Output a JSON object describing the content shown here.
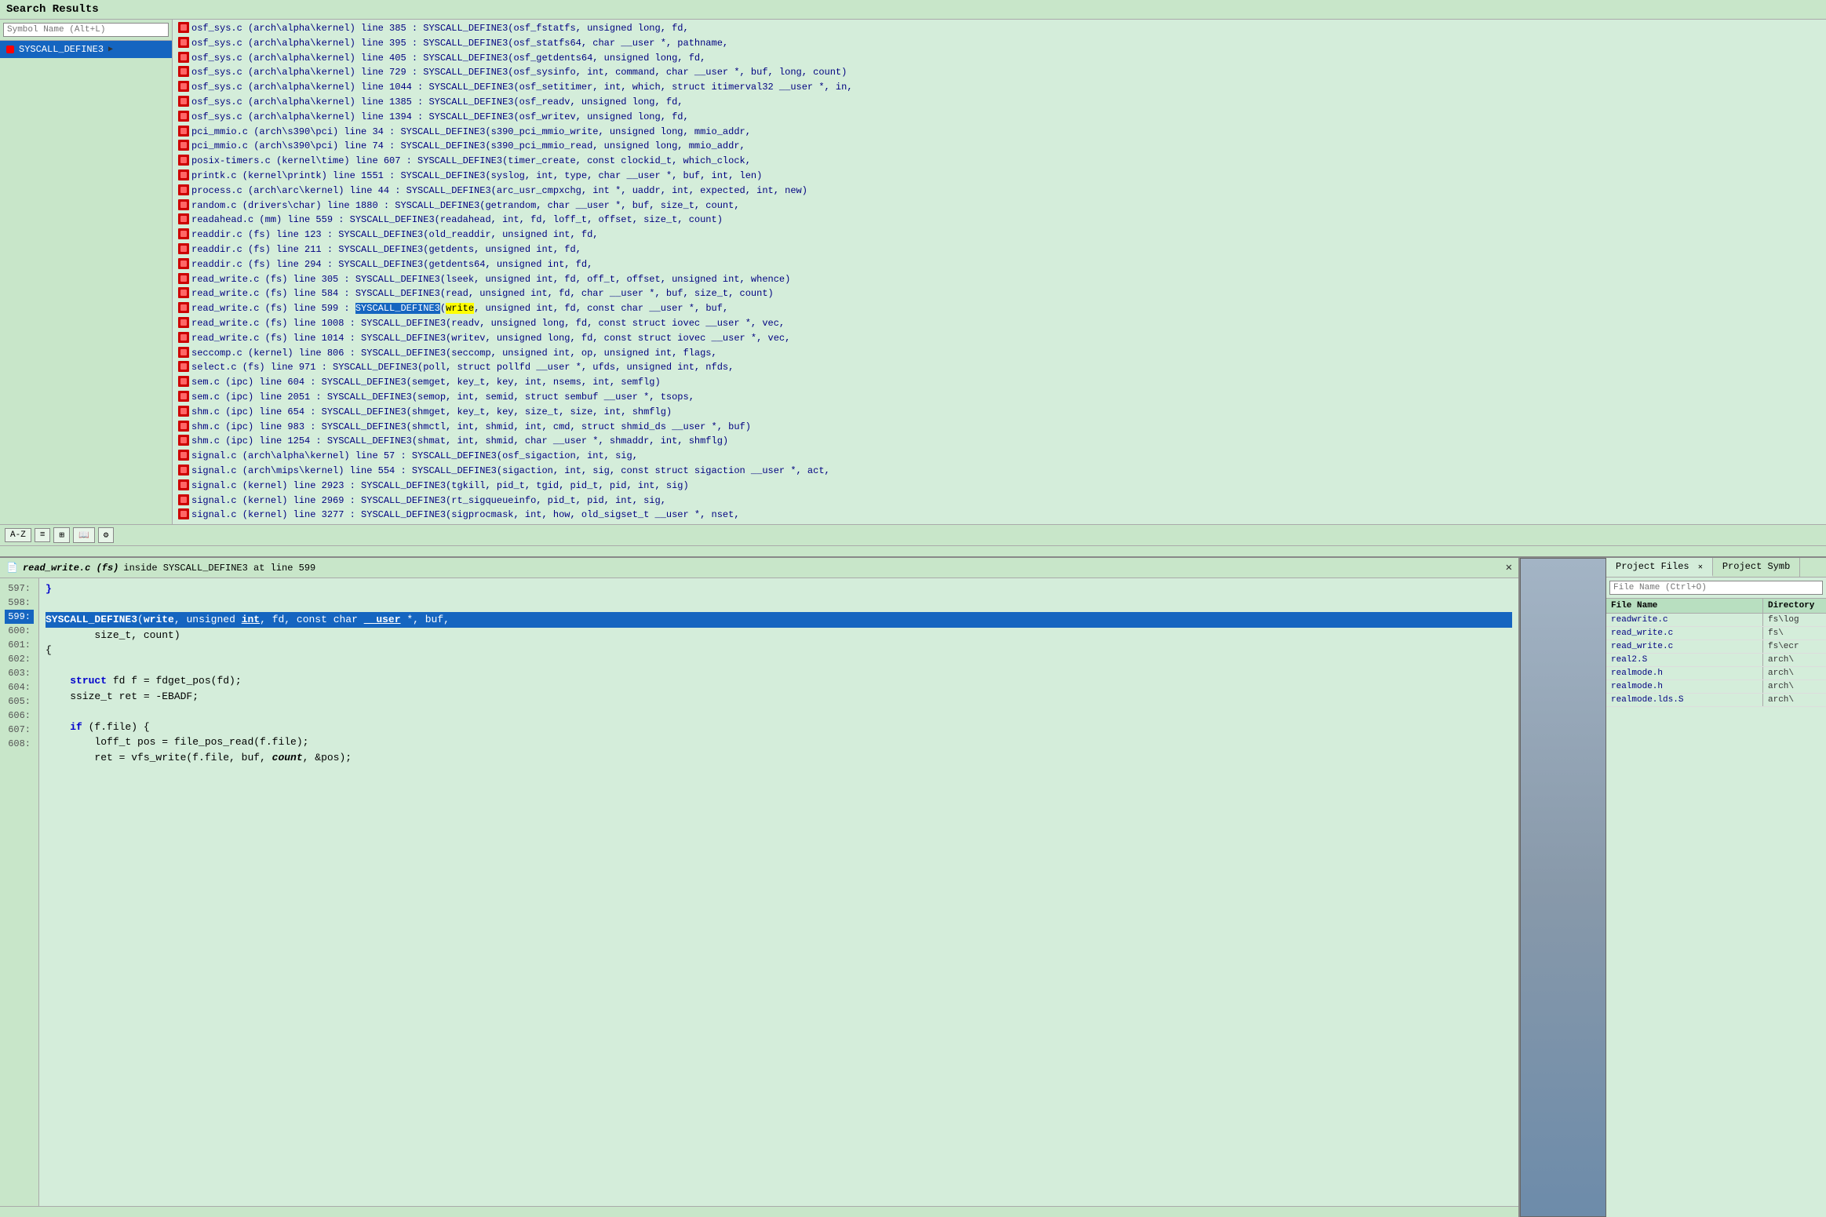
{
  "searchResults": {
    "title": "Search Results",
    "symbolSearchPlaceholder": "Symbol Name (Alt+L)",
    "selectedSymbol": "SYSCALL_DEFINE3",
    "results": [
      "osf_sys.c (arch\\alpha\\kernel) line 385 : SYSCALL_DEFINE3(osf_fstatfs, unsigned long, fd,",
      "osf_sys.c (arch\\alpha\\kernel) line 395 : SYSCALL_DEFINE3(osf_statfs64, char __user *, pathname,",
      "osf_sys.c (arch\\alpha\\kernel) line 405 : SYSCALL_DEFINE3(osf_getdents64, unsigned long, fd,",
      "osf_sys.c (arch\\alpha\\kernel) line 729 : SYSCALL_DEFINE3(osf_sysinfo, int, command, char __user *, buf, long, count)",
      "osf_sys.c (arch\\alpha\\kernel) line 1044 : SYSCALL_DEFINE3(osf_setitimer, int, which, struct itimerval32 __user *, in,",
      "osf_sys.c (arch\\alpha\\kernel) line 1385 : SYSCALL_DEFINE3(osf_readv, unsigned long, fd,",
      "osf_sys.c (arch\\alpha\\kernel) line 1394 : SYSCALL_DEFINE3(osf_writev, unsigned long, fd,",
      "pci_mmio.c (arch\\s390\\pci) line 34 : SYSCALL_DEFINE3(s390_pci_mmio_write, unsigned long, mmio_addr,",
      "pci_mmio.c (arch\\s390\\pci) line 74 : SYSCALL_DEFINE3(s390_pci_mmio_read, unsigned long, mmio_addr,",
      "posix-timers.c (kernel\\time) line 607 : SYSCALL_DEFINE3(timer_create, const clockid_t, which_clock,",
      "printk.c (kernel\\printk) line 1551 : SYSCALL_DEFINE3(syslog, int, type, char __user *, buf, int, len)",
      "process.c (arch\\arc\\kernel) line 44 : SYSCALL_DEFINE3(arc_usr_cmpxchg, int *, uaddr, int, expected, int, new)",
      "random.c (drivers\\char) line 1880 : SYSCALL_DEFINE3(getrandom, char __user *, buf, size_t, count,",
      "readahead.c (mm) line 559 : SYSCALL_DEFINE3(readahead, int, fd, loff_t, offset, size_t, count)",
      "readdir.c (fs) line 123 : SYSCALL_DEFINE3(old_readdir, unsigned int, fd,",
      "readdir.c (fs) line 211 : SYSCALL_DEFINE3(getdents, unsigned int, fd,",
      "readdir.c (fs) line 294 : SYSCALL_DEFINE3(getdents64, unsigned int, fd,",
      "read_write.c (fs) line 305 : SYSCALL_DEFINE3(lseek, unsigned int, fd, off_t, offset, unsigned int, whence)",
      "read_write.c (fs) line 584 : SYSCALL_DEFINE3(read, unsigned int, fd, char __user *, buf, size_t, count)",
      "read_write.c (fs) line 599 : SYSCALL_DEFINE3(write, unsigned int, fd, const char __user *, buf,",
      "read_write.c (fs) line 1008 : SYSCALL_DEFINE3(readv, unsigned long, fd, const struct iovec __user *, vec,",
      "read_write.c (fs) line 1014 : SYSCALL_DEFINE3(writev, unsigned long, fd, const struct iovec __user *, vec,",
      "seccomp.c (kernel) line 806 : SYSCALL_DEFINE3(seccomp, unsigned int, op, unsigned int, flags,",
      "select.c (fs) line 971 : SYSCALL_DEFINE3(poll, struct pollfd __user *, ufds, unsigned int, nfds,",
      "sem.c (ipc) line 604 : SYSCALL_DEFINE3(semget, key_t, key, int, nsems, int, semflg)",
      "sem.c (ipc) line 2051 : SYSCALL_DEFINE3(semop, int, semid, struct sembuf __user *, tsops,",
      "shm.c (ipc) line 654 : SYSCALL_DEFINE3(shmget, key_t, key, size_t, size, int, shmflg)",
      "shm.c (ipc) line 983 : SYSCALL_DEFINE3(shmctl, int, shmid, int, cmd, struct shmid_ds __user *, buf)",
      "shm.c (ipc) line 1254 : SYSCALL_DEFINE3(shmat, int, shmid, char __user *, shmaddr, int, shmflg)",
      "signal.c (arch\\alpha\\kernel) line 57 : SYSCALL_DEFINE3(osf_sigaction, int, sig,",
      "signal.c (arch\\mips\\kernel) line 554 : SYSCALL_DEFINE3(sigaction, int, sig, const struct sigaction __user *, act,",
      "signal.c (kernel) line 2923 : SYSCALL_DEFINE3(tgkill, pid_t, tgid, pid_t, pid, int, sig)",
      "signal.c (kernel) line 2969 : SYSCALL_DEFINE3(rt_sigqueueinfo, pid_t, pid, int, sig,",
      "signal.c (kernel) line 3277 : SYSCALL_DEFINE3(sigprocmask, int, how, old_sigset_t __user *, nset,"
    ],
    "highlightedLine": 19,
    "highlightedFunc": "SYSCALL_DEFINE3",
    "highlightedArg": "write"
  },
  "toolbar": {
    "items": [
      "A-Z",
      "📋",
      "🔧",
      "📖",
      "⚙"
    ]
  },
  "editor": {
    "titlePrefix": "inside SYSCALL_DEFINE3 at line 599",
    "filename": "read_write.c (fs)",
    "lines": [
      {
        "num": "597:",
        "code": "}"
      },
      {
        "num": "598:",
        "code": ""
      },
      {
        "num": "599:",
        "code": "SYSCALL_DEFINE3(write, unsigned int, fd, const char __user *, buf,",
        "selected": true
      },
      {
        "num": "600:",
        "code": "        size_t, count)"
      },
      {
        "num": "601:",
        "code": "{"
      },
      {
        "num": "602:",
        "code": ""
      },
      {
        "num": "603:",
        "code": "    struct fd f = fdget_pos(fd);"
      },
      {
        "num": "604:",
        "code": "    ssize_t ret = -EBADF;"
      },
      {
        "num": "605:",
        "code": ""
      },
      {
        "num": "606:",
        "code": "    if (f.file) {"
      },
      {
        "num": "607:",
        "code": "        loff_t pos = file_pos_read(f.file);"
      },
      {
        "num": "608:",
        "code": "        ret = vfs_write(f.file, buf, count, &pos);"
      }
    ]
  },
  "rightPanel": {
    "tabs": [
      {
        "label": "Project Files",
        "active": true,
        "closable": true
      },
      {
        "label": "Project Symb",
        "active": false,
        "closable": false
      }
    ],
    "searchPlaceholder": "File Name (Ctrl+O)",
    "columns": [
      "File Name",
      "Directory"
    ],
    "files": [
      {
        "name": "readwrite.c",
        "dir": "fs\\log"
      },
      {
        "name": "read_write.c",
        "dir": "fs\\"
      },
      {
        "name": "read_write.c",
        "dir": "fs\\ecr"
      },
      {
        "name": "real2.S",
        "dir": "arch\\"
      },
      {
        "name": "realmode.h",
        "dir": "arch\\"
      },
      {
        "name": "realmode.h",
        "dir": "arch\\"
      },
      {
        "name": "realmode.lds.S",
        "dir": "arch\\"
      }
    ]
  }
}
